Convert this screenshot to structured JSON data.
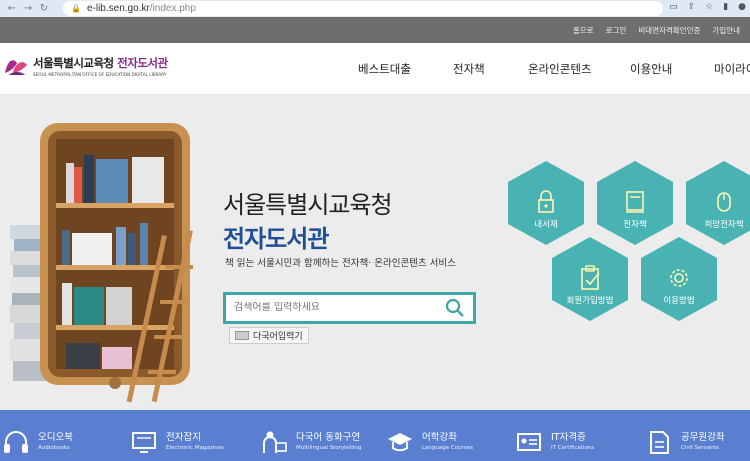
{
  "browser": {
    "back_icon": "arrow-left-icon",
    "forward_icon": "arrow-right-icon",
    "reload_icon": "reload-icon",
    "url_domain": "e-lib.sen.go.kr",
    "url_path": "/index.php"
  },
  "util_links": [
    "홈으로",
    "로그인",
    "비대면자격확인인증",
    "가입안내"
  ],
  "logo": {
    "name_plain": "서울특별시교육청 ",
    "name_accent": "전자도서관",
    "english": "SEOUL METROPOLITAN OFFICE OF EDUCATION DIGITAL LIBRARY",
    "accent_color": "#8b2a8f"
  },
  "gnb": [
    "베스트대출",
    "전자책",
    "온라인콘텐츠",
    "이용안내",
    "마이라이"
  ],
  "hero": {
    "title_line1": "서울특별시교육청",
    "title_line2": "전자도서관",
    "subtitle": "책 읽는 서울시민과 함께하는 전자책· 온라인콘텐츠 서비스",
    "search_placeholder": "검색어를 입력하세요",
    "multi_lang_label": "다국어입력기"
  },
  "hex_menu": [
    {
      "label": "내서재",
      "icon": "lock-icon"
    },
    {
      "label": "전자책",
      "icon": "book-icon"
    },
    {
      "label": "희망전자책",
      "icon": "mouse-icon"
    },
    {
      "label": "회원가입방법",
      "icon": "clipboard-icon"
    },
    {
      "label": "이용방법",
      "icon": "gear-icon"
    }
  ],
  "quick_menu": [
    {
      "title": "오디오북",
      "sub": "Audiobooks",
      "icon": "headphones-icon"
    },
    {
      "title": "전자잡지",
      "sub": "Electronic Magazines",
      "icon": "monitor-icon"
    },
    {
      "title": "다국어 동화구연",
      "sub": "Multilingual Storytelling",
      "icon": "storyteller-icon"
    },
    {
      "title": "어학강좌",
      "sub": "Language Courses",
      "icon": "graduation-cap-icon"
    },
    {
      "title": "IT자격증",
      "sub": "IT Certifications",
      "icon": "id-card-icon"
    },
    {
      "title": "공무원강좌",
      "sub": "Civil Servants",
      "icon": "document-icon"
    }
  ],
  "colors": {
    "teal": "#49b3b4",
    "band": "#5a7fd0",
    "title_blue": "#1f4f94"
  }
}
